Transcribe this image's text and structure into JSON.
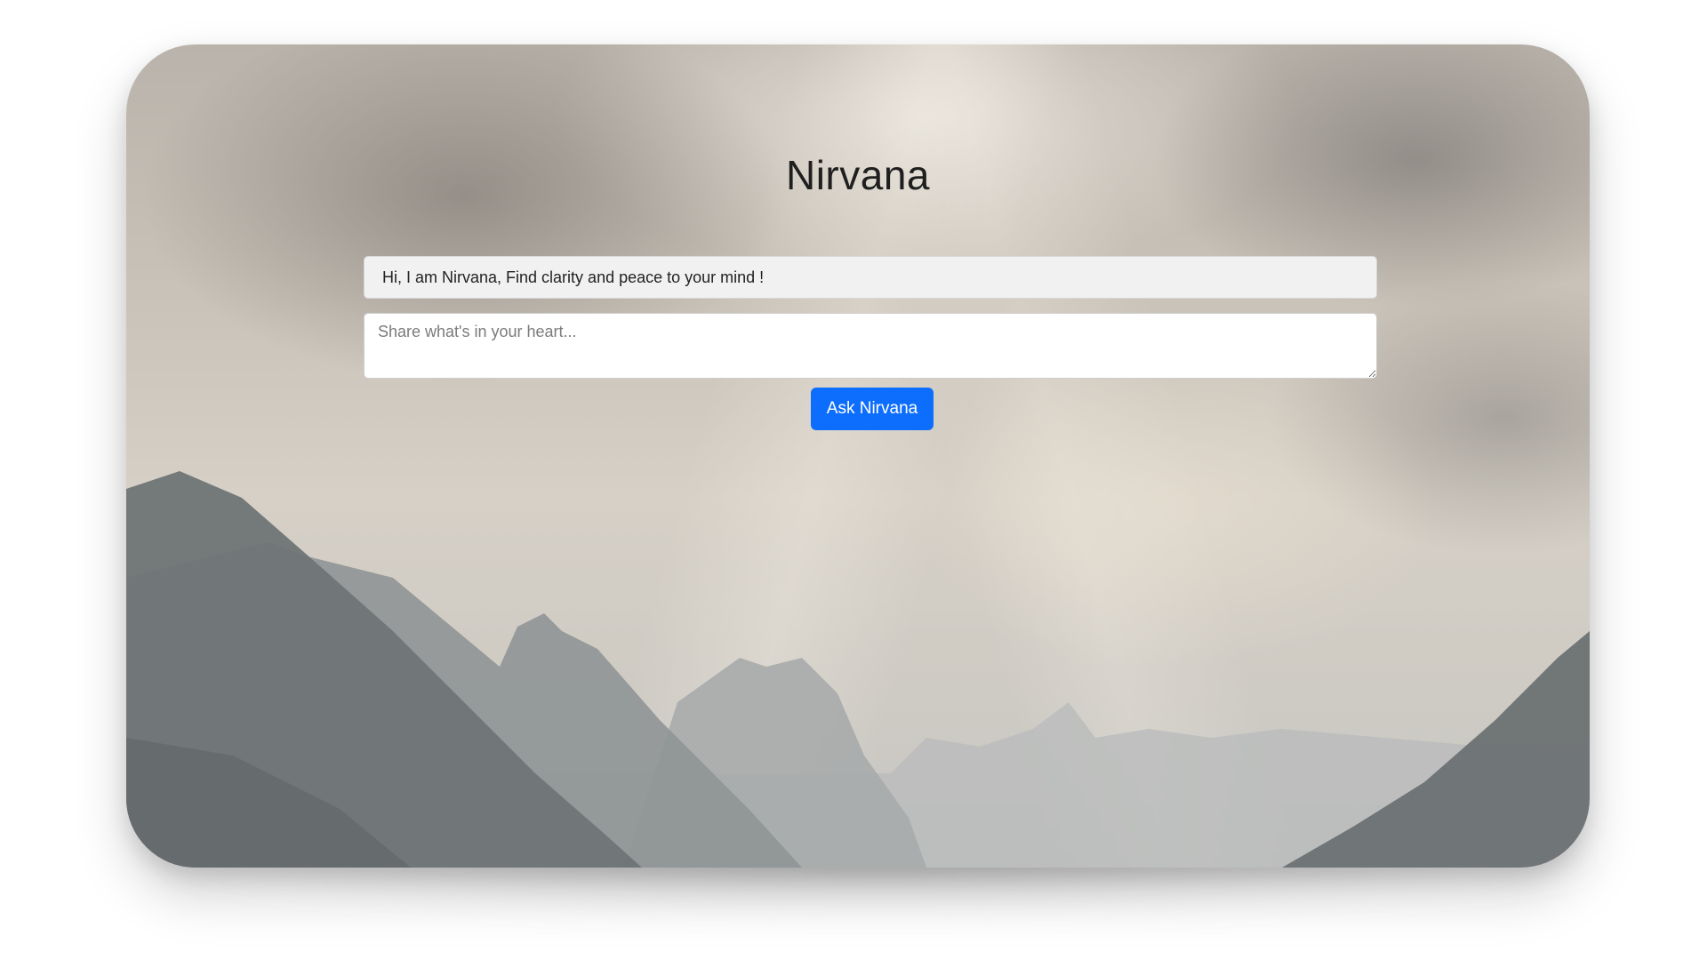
{
  "app": {
    "title": "Nirvana"
  },
  "greeting": {
    "text": "Hi, I am Nirvana, Find clarity and peace to your mind !"
  },
  "message_input": {
    "value": "",
    "placeholder": "Share what's in your heart..."
  },
  "ask_button": {
    "label": "Ask Nirvana"
  },
  "colors": {
    "accent": "#0d6efd",
    "title_text": "#1f1f1f"
  }
}
